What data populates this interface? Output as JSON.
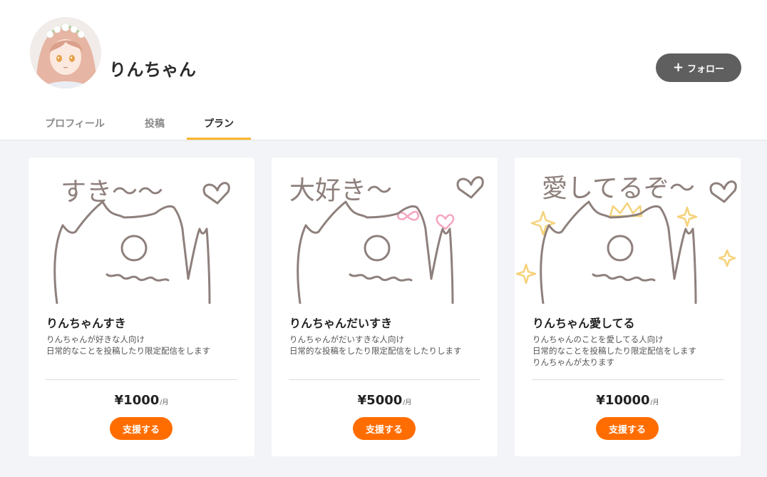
{
  "profile": {
    "username": "りんちゃん",
    "follow_label": "フォロー"
  },
  "tabs": [
    {
      "label": "プロフィール"
    },
    {
      "label": "投稿"
    },
    {
      "label": "プラン",
      "active": true
    }
  ],
  "plans": [
    {
      "illustration_text": "すき〜〜",
      "title": "りんちゃんすき",
      "desc_lines": [
        "りんちゃんが好きな人向け",
        "日常的なことを投稿したり限定配信をします"
      ],
      "price": "¥1000",
      "unit": "/月",
      "button_label": "支援する"
    },
    {
      "illustration_text": "大好き〜",
      "title": "りんちゃんだいすき",
      "desc_lines": [
        "りんちゃんがだいすきな人向け",
        "日常的な投稿をしたり限定配信をしたりします"
      ],
      "price": "¥5000",
      "unit": "/月",
      "button_label": "支援する"
    },
    {
      "illustration_text": "愛してるぞ〜",
      "title": "りんちゃん愛してる",
      "desc_lines": [
        "りんちゃんのことを愛してる人向け",
        "日常的なことを投稿したり限定配信をします",
        "りんちゃんが太ります"
      ],
      "price": "¥10000",
      "unit": "/月",
      "button_label": "支援する"
    }
  ],
  "colors": {
    "accent_orange": "#ff6d00",
    "tab_underline": "#f8b62b",
    "follow_bg": "#5f5f5f",
    "page_bg": "#f3f4f7",
    "sketch_line": "#8e807c",
    "sketch_pink": "#f5a5c0",
    "sketch_gold": "#f5d27a"
  }
}
